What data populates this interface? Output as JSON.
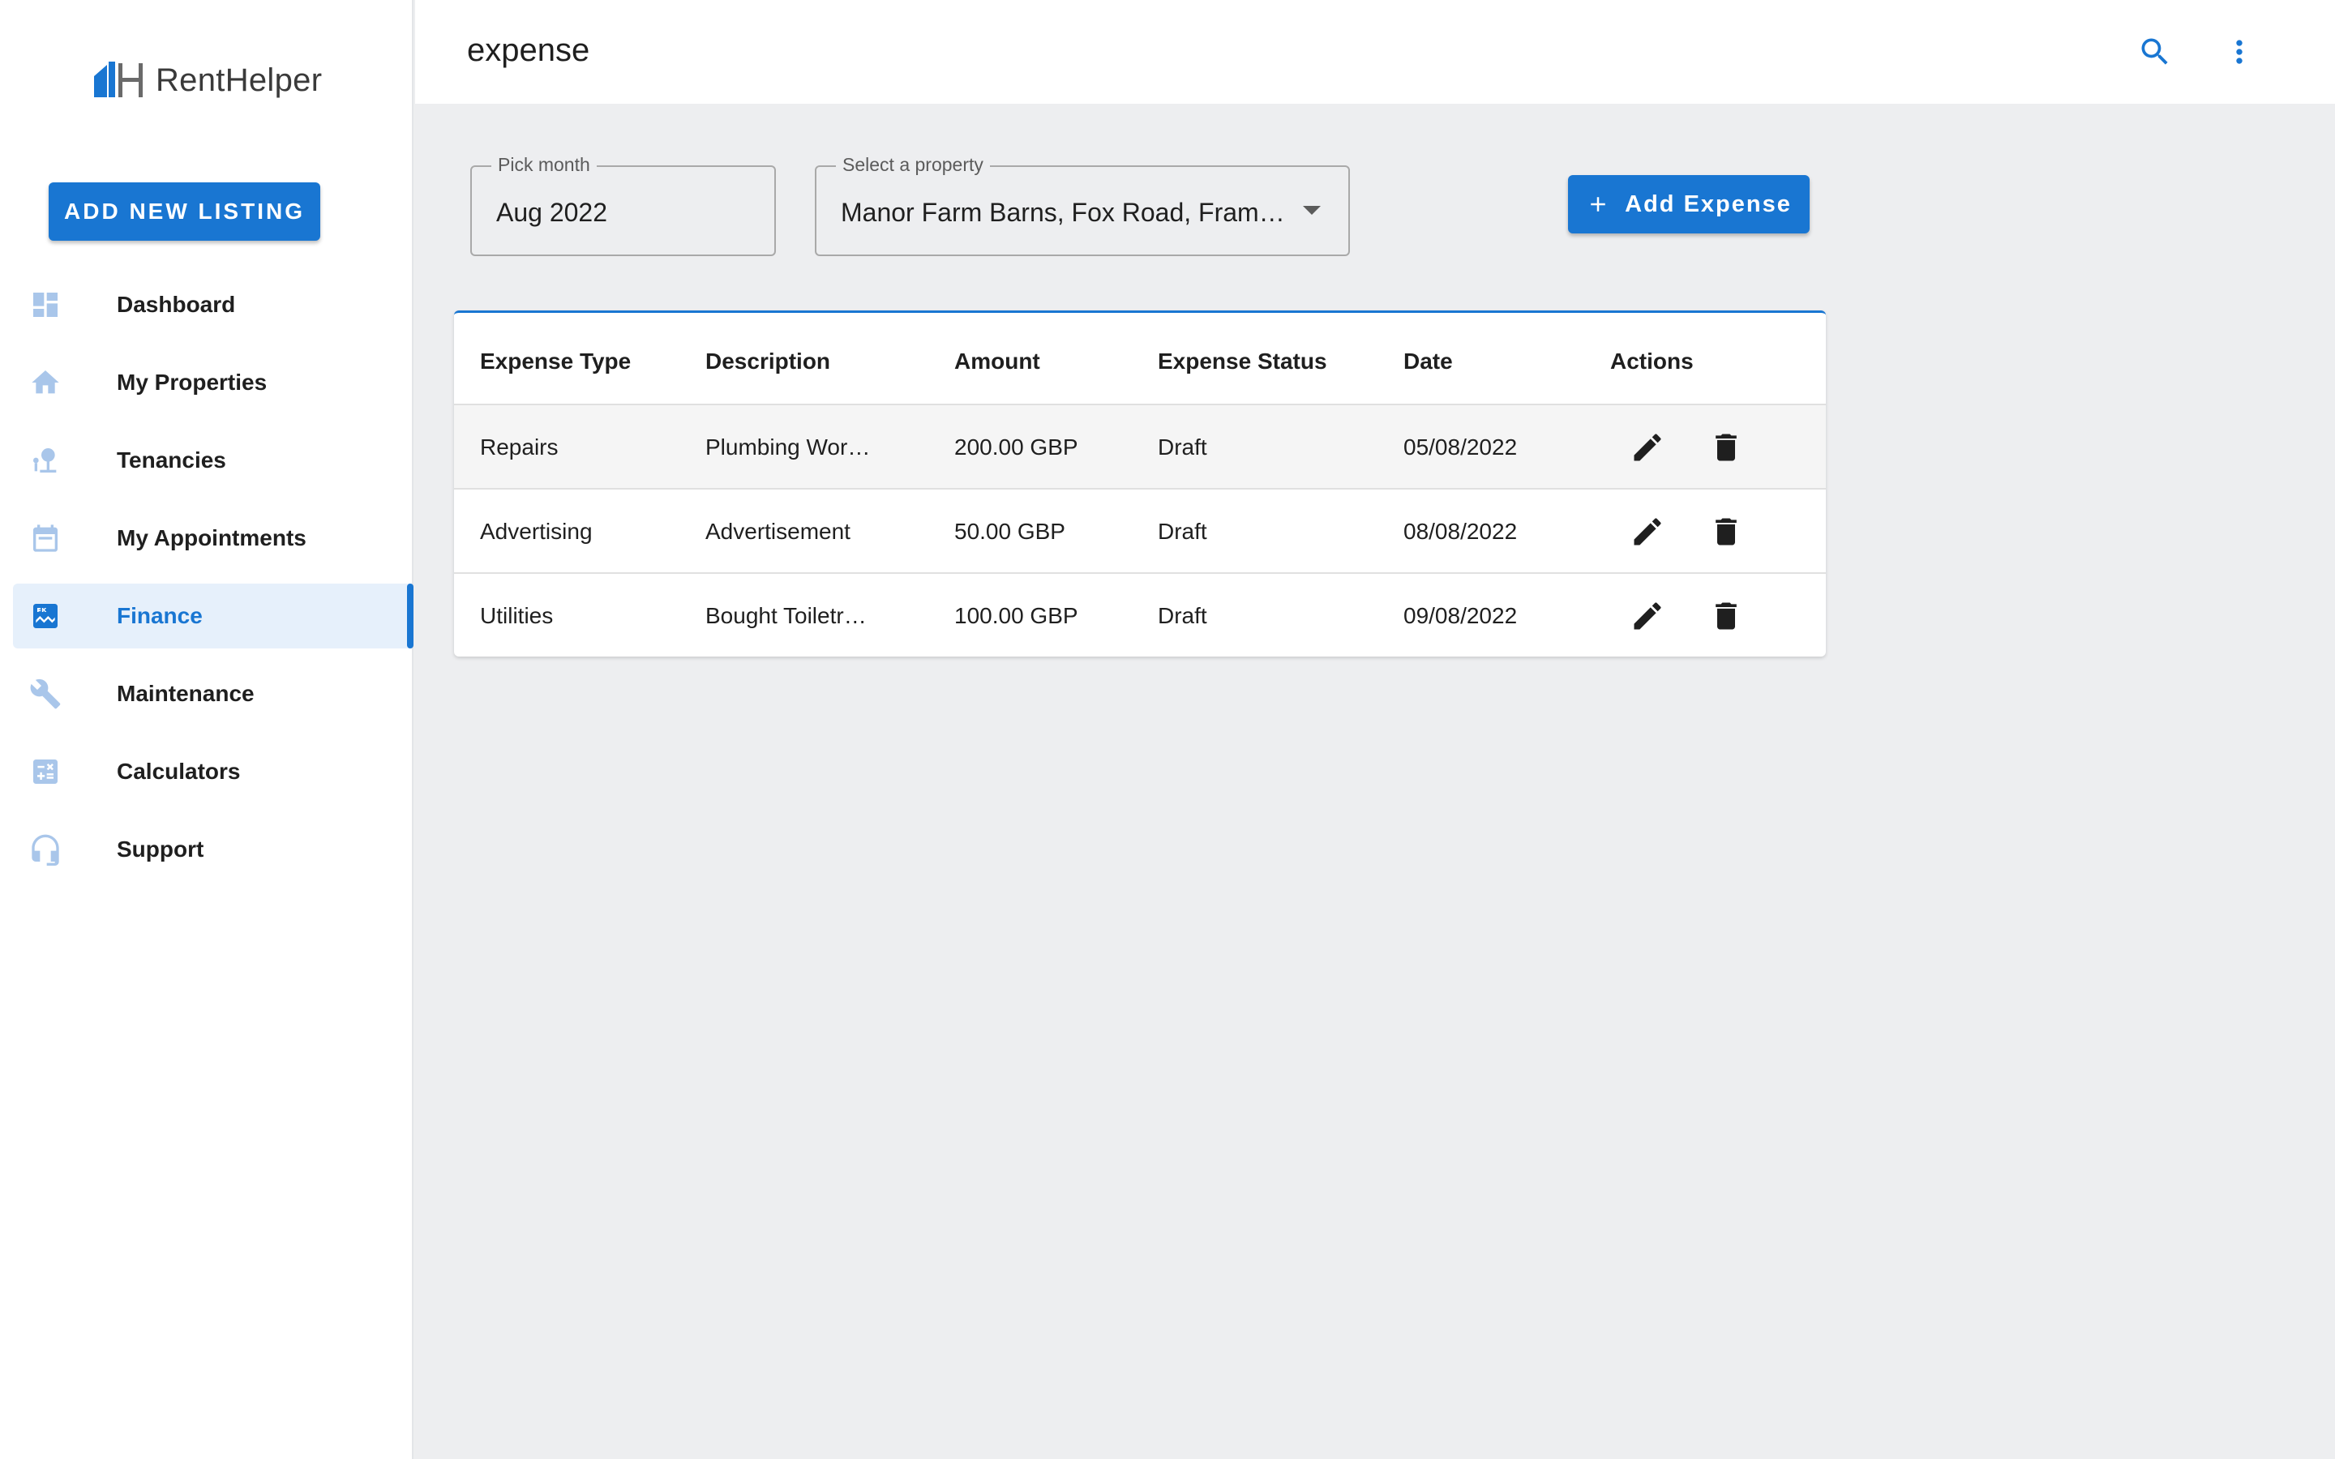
{
  "app": {
    "brand": "RentHelper",
    "add_listing_label": "ADD NEW LISTING"
  },
  "sidebar": {
    "items": [
      {
        "label": "Dashboard",
        "icon": "dashboard-icon",
        "active": false
      },
      {
        "label": "My Properties",
        "icon": "home-icon",
        "active": false
      },
      {
        "label": "Tenancies",
        "icon": "tenant-icon",
        "active": false
      },
      {
        "label": "My Appointments",
        "icon": "calendar-icon",
        "active": false
      },
      {
        "label": "Finance",
        "icon": "finance-icon",
        "active": true
      },
      {
        "label": "Maintenance",
        "icon": "wrench-icon",
        "active": false
      },
      {
        "label": "Calculators",
        "icon": "calculator-icon",
        "active": false
      },
      {
        "label": "Support",
        "icon": "headset-icon",
        "active": false
      }
    ]
  },
  "header": {
    "title": "expense",
    "icons": [
      "search-icon",
      "more-vert-icon"
    ]
  },
  "filters": {
    "month": {
      "label": "Pick month",
      "value": "Aug 2022"
    },
    "property": {
      "label": "Select a property",
      "value": "Manor Farm Barns, Fox Road, Fram…"
    }
  },
  "toolbar": {
    "add_expense_label": "Add Expense"
  },
  "table": {
    "columns": [
      "Expense Type",
      "Description",
      "Amount",
      "Expense Status",
      "Date",
      "Actions"
    ],
    "rows": [
      {
        "type": "Repairs",
        "description": "Plumbing Wor…",
        "amount": "200.00 GBP",
        "status": "Draft",
        "date": "05/08/2022"
      },
      {
        "type": "Advertising",
        "description": "Advertisement",
        "amount": "50.00 GBP",
        "status": "Draft",
        "date": "08/08/2022"
      },
      {
        "type": "Utilities",
        "description": "Bought Toiletr…",
        "amount": "100.00 GBP",
        "status": "Draft",
        "date": "09/08/2022"
      }
    ]
  },
  "colors": {
    "primary": "#1976d2",
    "sidebar_icon_inactive": "#a9c6ea",
    "active_bg": "#e6f0fb",
    "page_bg": "#edeef0"
  }
}
